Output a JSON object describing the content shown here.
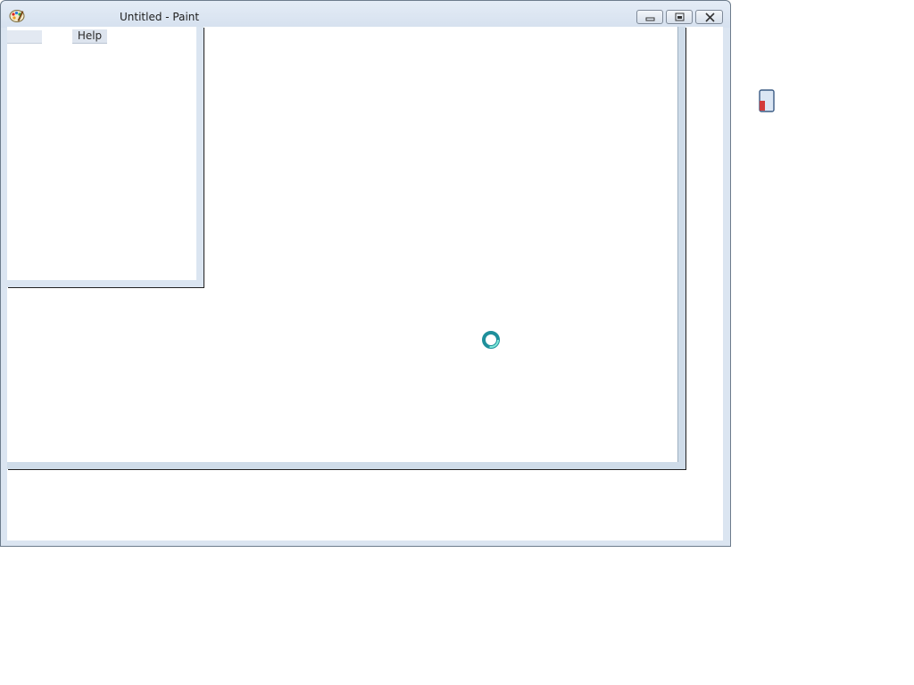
{
  "window": {
    "title": "Untitled - Paint",
    "app_icon": "paint-palette-icon"
  },
  "caption_buttons": {
    "minimize": "minimize-icon",
    "maximize": "restore-icon",
    "close": "close-icon"
  },
  "menu": {
    "items": [
      {
        "label": ""
      },
      {
        "label": "Help"
      }
    ]
  },
  "cursor": {
    "type": "busy-spinner-icon"
  },
  "desktop": {
    "partial_icon": "app-shortcut-icon"
  },
  "colors": {
    "frame": "#dbe5f1",
    "canvas_border": "#cfdce9",
    "cursor_teal": "#22b7b2"
  }
}
